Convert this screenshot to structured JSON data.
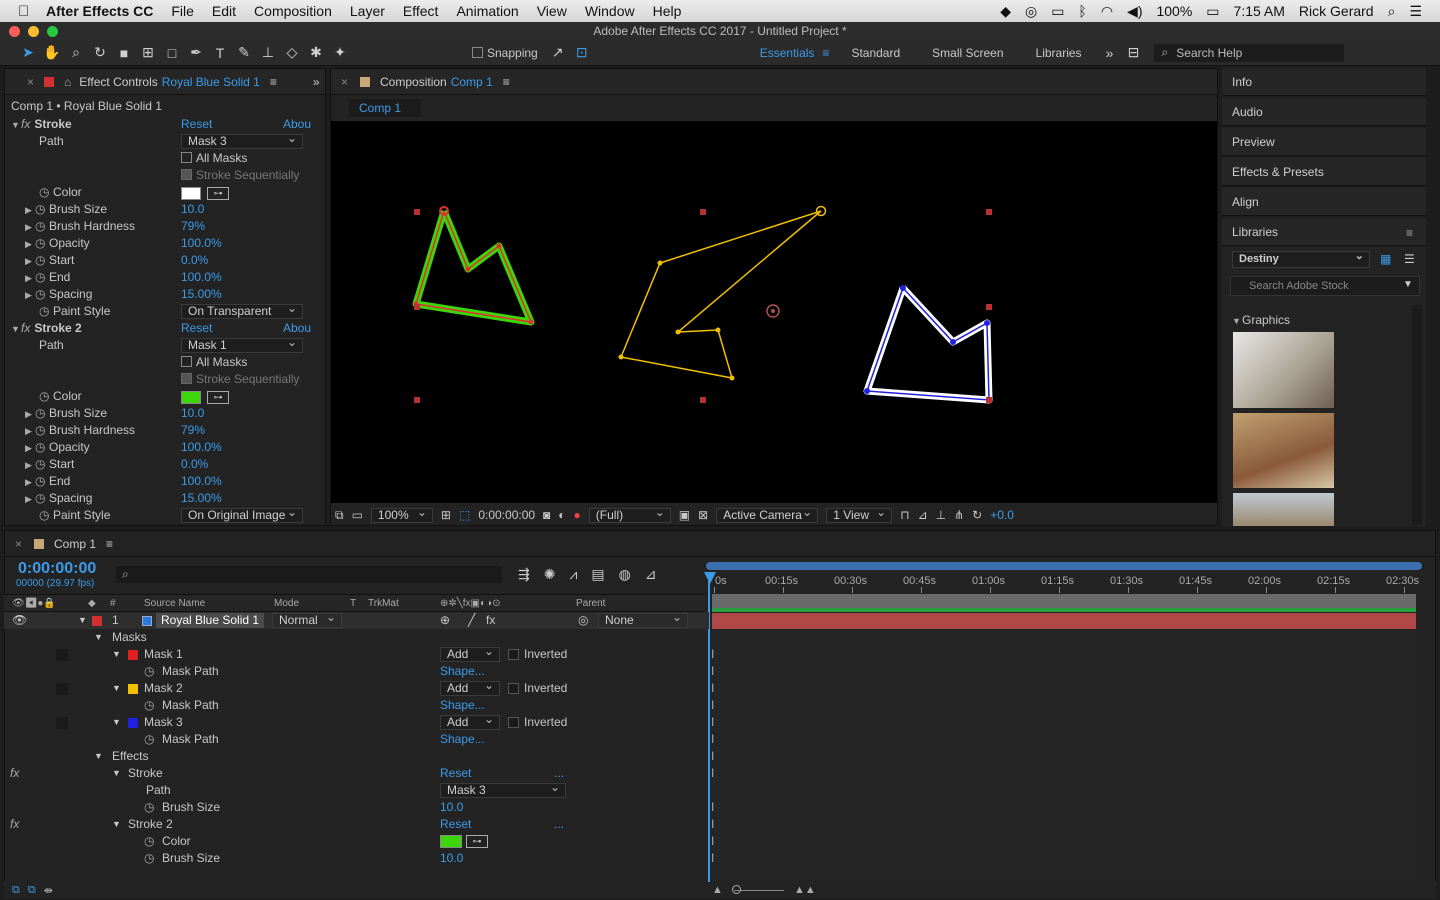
{
  "menubar": {
    "app": "After Effects CC",
    "items": [
      "File",
      "Edit",
      "Composition",
      "Layer",
      "Effect",
      "Animation",
      "View",
      "Window",
      "Help"
    ],
    "battery": "100%",
    "time": "7:15 AM",
    "user": "Rick Gerard"
  },
  "window": {
    "title": "Adobe After Effects CC 2017 - Untitled Project *"
  },
  "toolbar": {
    "snapping": "Snapping",
    "workspaces": [
      "Essentials",
      "Standard",
      "Small Screen",
      "Libraries"
    ],
    "active_workspace": "Essentials",
    "search_placeholder": "Search Help"
  },
  "effect_controls": {
    "tab_prefix": "Effect Controls",
    "tab_layer": "Royal Blue Solid 1",
    "breadcrumb": "Comp 1 • Royal Blue Solid 1",
    "stroke1": {
      "name": "Stroke",
      "reset": "Reset",
      "about": "Abou",
      "path_label": "Path",
      "path_value": "Mask 3",
      "all_masks": "All Masks",
      "stroke_seq": "Stroke Sequentially",
      "color_label": "Color",
      "color": "#ffffff",
      "props": [
        {
          "label": "Brush Size",
          "value": "10.0"
        },
        {
          "label": "Brush Hardness",
          "value": "79%"
        },
        {
          "label": "Opacity",
          "value": "100.0%"
        },
        {
          "label": "Start",
          "value": "0.0%"
        },
        {
          "label": "End",
          "value": "100.0%"
        },
        {
          "label": "Spacing",
          "value": "15.00%"
        }
      ],
      "paint_label": "Paint Style",
      "paint_value": "On Transparent"
    },
    "stroke2": {
      "name": "Stroke 2",
      "reset": "Reset",
      "about": "Abou",
      "path_label": "Path",
      "path_value": "Mask 1",
      "all_masks": "All Masks",
      "stroke_seq": "Stroke Sequentially",
      "color_label": "Color",
      "color": "#3cd60a",
      "props": [
        {
          "label": "Brush Size",
          "value": "10.0"
        },
        {
          "label": "Brush Hardness",
          "value": "79%"
        },
        {
          "label": "Opacity",
          "value": "100.0%"
        },
        {
          "label": "Start",
          "value": "0.0%"
        },
        {
          "label": "End",
          "value": "100.0%"
        },
        {
          "label": "Spacing",
          "value": "15.00%"
        }
      ],
      "paint_label": "Paint Style",
      "paint_value": "On Original Image"
    }
  },
  "composition": {
    "tab_prefix": "Composition",
    "tab_comp": "Comp 1",
    "subtab": "Comp 1",
    "zoom": "100%",
    "timecode": "0:00:00:00",
    "resolution": "(Full)",
    "camera": "Active Camera",
    "views": "1 View",
    "exposure": "+0.0"
  },
  "right_panels": {
    "items": [
      "Info",
      "Audio",
      "Preview",
      "Effects & Presets",
      "Align",
      "Libraries"
    ],
    "library": "Destiny",
    "stock_placeholder": "Search Adobe Stock",
    "graphics": "Graphics"
  },
  "timeline": {
    "tab": "Comp 1",
    "timecode": "0:00:00:00",
    "frames": "00000 (29.97 fps)",
    "headers": {
      "source": "Source Name",
      "mode": "Mode",
      "t": "T",
      "trkmat": "TrkMat",
      "parent": "Parent"
    },
    "layer": {
      "num": "1",
      "name": "Royal Blue Solid 1",
      "mode": "Normal",
      "parent": "None"
    },
    "masks_label": "Masks",
    "masks": [
      {
        "name": "Mask 1",
        "color": "#e02020",
        "mode": "Add",
        "inverted": "Inverted",
        "prop": "Mask Path",
        "value": "Shape..."
      },
      {
        "name": "Mask 2",
        "color": "#f0c000",
        "mode": "Add",
        "inverted": "Inverted",
        "prop": "Mask Path",
        "value": "Shape..."
      },
      {
        "name": "Mask 3",
        "color": "#2020e0",
        "mode": "Add",
        "inverted": "Inverted",
        "prop": "Mask Path",
        "value": "Shape..."
      }
    ],
    "effects_label": "Effects",
    "stroke": {
      "name": "Stroke",
      "reset": "Reset",
      "dots": "...",
      "path_label": "Path",
      "path_value": "Mask 3",
      "brush_label": "Brush Size",
      "brush_value": "10.0"
    },
    "stroke2": {
      "name": "Stroke 2",
      "reset": "Reset",
      "dots": "...",
      "color_label": "Color",
      "color": "#3cd60a",
      "brush_label": "Brush Size",
      "brush_value": "10.0"
    },
    "ruler": [
      "0s",
      "00:15s",
      "00:30s",
      "00:45s",
      "01:00s",
      "01:15s",
      "01:30s",
      "01:45s",
      "02:00s",
      "02:15s",
      "02:30s"
    ]
  }
}
